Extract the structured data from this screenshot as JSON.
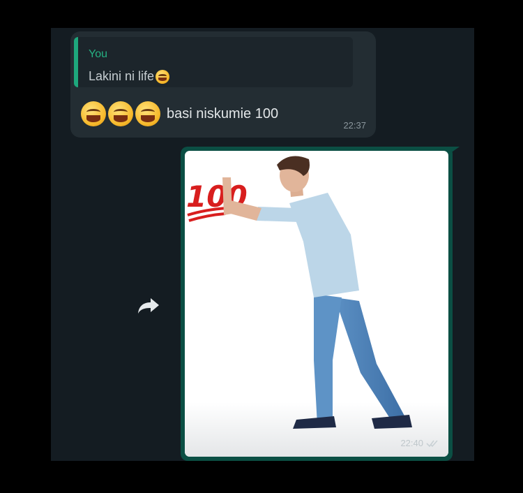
{
  "chat": {
    "incoming": {
      "reply_to": {
        "author": "You",
        "text": "Lakini ni life",
        "emoji": "joy-emoji"
      },
      "emojis": [
        "joy-emoji",
        "joy-emoji",
        "joy-emoji"
      ],
      "text": "basi niskumie 100",
      "time": "22:37"
    },
    "forward_icon": "forward-arrow-icon",
    "outgoing": {
      "image_sticker": "100",
      "time": "22:40",
      "status_icon": "double-check-icon"
    }
  },
  "colors": {
    "background": "#141c22",
    "bubble_in": "#232d33",
    "bubble_out_border": "#0b4f44",
    "accent": "#26b283"
  }
}
